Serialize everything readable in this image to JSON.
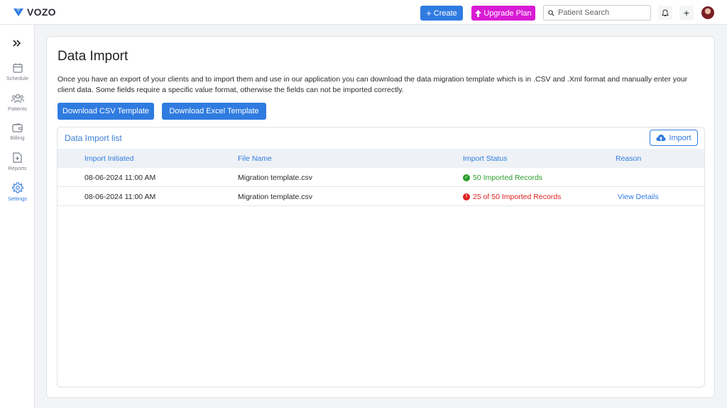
{
  "colors": {
    "primary": "#2f7be0",
    "upgrade": "#d81bd4",
    "success": "#2a9d2a",
    "error": "#e02020"
  },
  "header": {
    "logo_text": "VOZO",
    "create_label": "Create",
    "upgrade_label": "Upgrade Plan",
    "search_placeholder": "Patient Search",
    "icons": [
      "bell-icon",
      "plus-icon",
      "avatar"
    ]
  },
  "sidebar": {
    "items": [
      {
        "label": "Schedule",
        "icon": "calendar-icon"
      },
      {
        "label": "Patients",
        "icon": "users-icon"
      },
      {
        "label": "Billing",
        "icon": "wallet-icon"
      },
      {
        "label": "Reports",
        "icon": "report-icon"
      },
      {
        "label": "Settings",
        "icon": "gear-icon",
        "active": true
      }
    ]
  },
  "main": {
    "title": "Data Import",
    "description": "Once you have an export of your clients and to import them and use in our application you can download the data migration template which is in .CSV and .Xml format and manually enter your client data. Some fields require a specific value format, otherwise the fields can not be imported correctly.",
    "download_csv_label": "Download CSV Template",
    "download_excel_label": "Download Excel Template",
    "list": {
      "title": "Data Import list",
      "import_label": "Import",
      "columns": [
        "Import Initiated",
        "File Name",
        "Import Status",
        "Reason"
      ],
      "rows": [
        {
          "initiated": "08-06-2024 11:00 AM",
          "file": "Migration template.csv",
          "status": "50 Imported Records",
          "status_type": "success",
          "reason": ""
        },
        {
          "initiated": "08-06-2024 11:00 AM",
          "file": "Migration template.csv",
          "status": "25 of 50 Imported Records",
          "status_type": "error",
          "reason": "View Details"
        }
      ]
    }
  }
}
